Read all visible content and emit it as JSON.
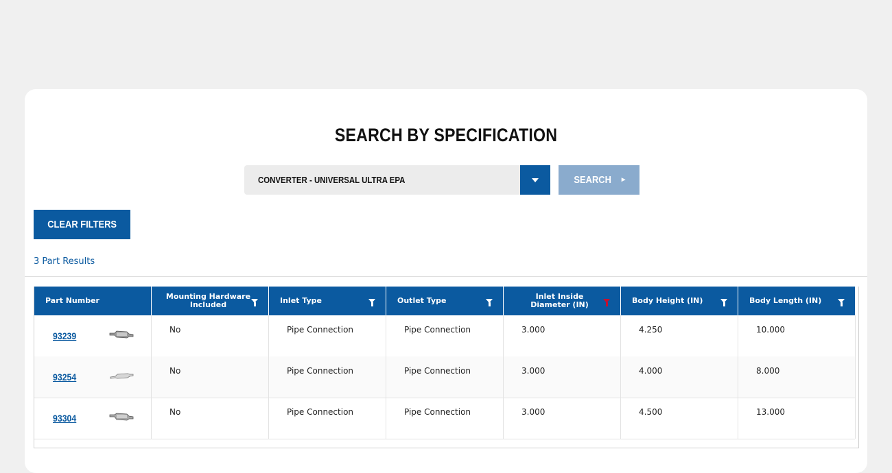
{
  "page": {
    "title": "SEARCH BY SPECIFICATION"
  },
  "search": {
    "selected_category": "CONVERTER - UNIVERSAL ULTRA EPA",
    "search_label": "SEARCH",
    "search_arrow": "►"
  },
  "filters": {
    "clear_label": "CLEAR FILTERS"
  },
  "results": {
    "count_text": "3 Part Results"
  },
  "table": {
    "columns": [
      {
        "label": "Part Number",
        "filter": false
      },
      {
        "label": "Mounting Hardware Included",
        "filter": true
      },
      {
        "label": "Inlet Type",
        "filter": true
      },
      {
        "label": "Outlet Type",
        "filter": true
      },
      {
        "label": "Inlet Inside Diameter (IN)",
        "filter": true,
        "active": true
      },
      {
        "label": "Body Height (IN)",
        "filter": true
      },
      {
        "label": "Body Length (IN)",
        "filter": true
      }
    ],
    "rows": [
      {
        "part": "93239",
        "mounting": "No",
        "inlet": "Pipe Connection",
        "outlet": "Pipe Connection",
        "diameter": "3.000",
        "height": "4.250",
        "length": "10.000"
      },
      {
        "part": "93254",
        "mounting": "No",
        "inlet": "Pipe Connection",
        "outlet": "Pipe Connection",
        "diameter": "3.000",
        "height": "4.000",
        "length": "8.000"
      },
      {
        "part": "93304",
        "mounting": "No",
        "inlet": "Pipe Connection",
        "outlet": "Pipe Connection",
        "diameter": "3.000",
        "height": "4.500",
        "length": "13.000"
      }
    ]
  },
  "colors": {
    "brand_blue": "#0b5aa0",
    "search_disabled": "#8aabcd",
    "filter_active": "#c8102e"
  }
}
